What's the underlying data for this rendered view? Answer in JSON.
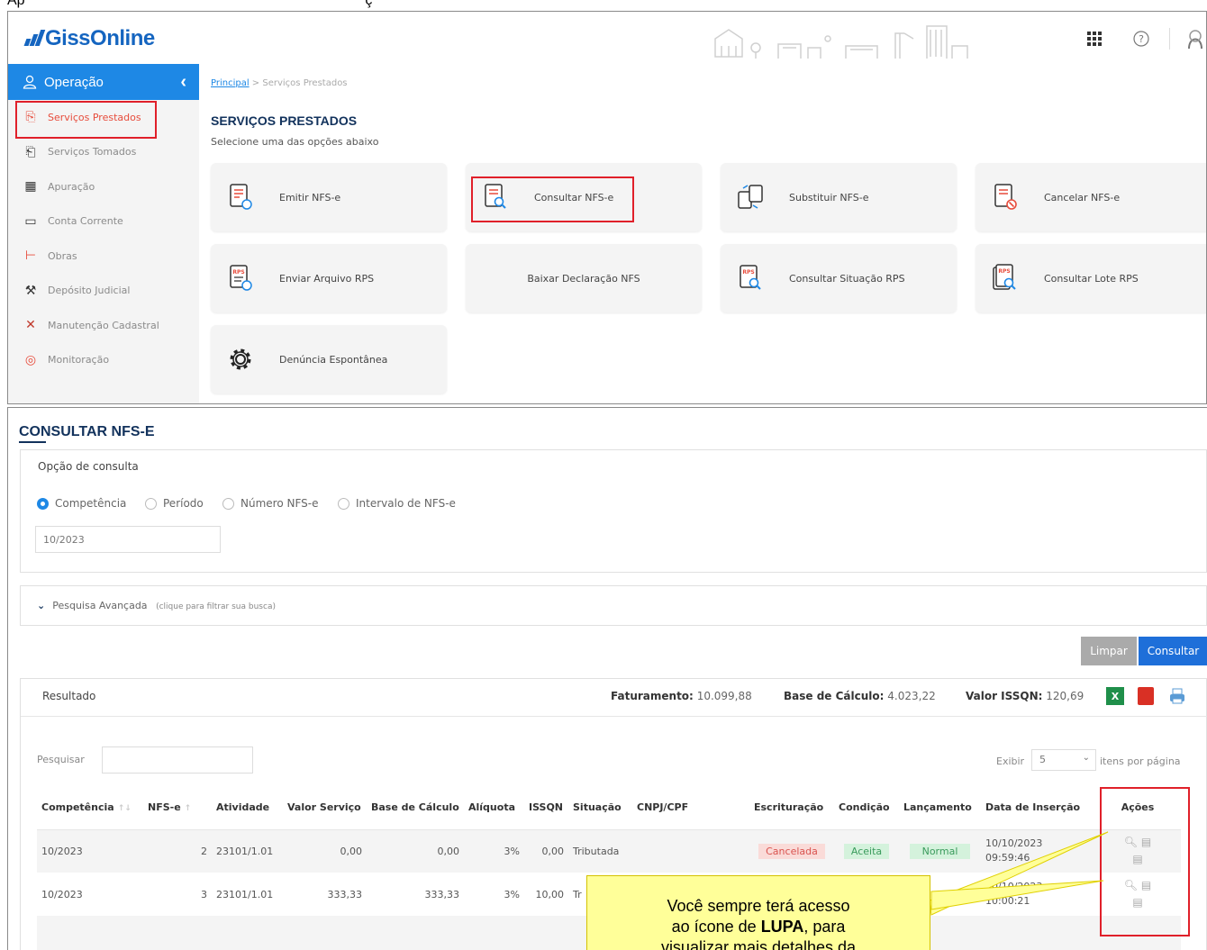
{
  "top_cut_text": "Ap                                                                                     ç",
  "brand": {
    "name": "GissOnline"
  },
  "sidebar": {
    "section_label": "Operação",
    "items": [
      {
        "label": "Serviços Prestados",
        "icon": "document-arrow-icon"
      },
      {
        "label": "Serviços Tomados",
        "icon": "document-arrow-in-icon"
      },
      {
        "label": "Apuração",
        "icon": "calculator-icon"
      },
      {
        "label": "Conta Corrente",
        "icon": "folder-icon"
      },
      {
        "label": "Obras",
        "icon": "crane-icon"
      },
      {
        "label": "Depósito Judicial",
        "icon": "gavel-icon"
      },
      {
        "label": "Manutenção Cadastral",
        "icon": "tools-icon"
      },
      {
        "label": "Monitoração",
        "icon": "eye-icon"
      }
    ]
  },
  "breadcrumb": {
    "home": "Principal",
    "sep": " > ",
    "current": "Serviços Prestados"
  },
  "services": {
    "title": "SERVIÇOS PRESTADOS",
    "subtitle": "Selecione uma das opções abaixo",
    "cards": [
      {
        "label": "Emitir NFS-e",
        "icon": "document-gear-icon"
      },
      {
        "label": "Consultar NFS-e",
        "icon": "document-search-icon"
      },
      {
        "label": "Substituir NFS-e",
        "icon": "document-swap-icon"
      },
      {
        "label": "Cancelar NFS-e",
        "icon": "document-cancel-icon"
      },
      {
        "label": "Enviar Arquivo RPS",
        "icon": "rps-upload-icon"
      },
      {
        "label": "Baixar Declaração NFS",
        "icon": ""
      },
      {
        "label": "Consultar Situação RPS",
        "icon": "rps-search-icon"
      },
      {
        "label": "Consultar Lote RPS",
        "icon": "rps-lot-search-icon"
      },
      {
        "label": "Denúncia Espontânea",
        "icon": "gear-icon"
      }
    ]
  },
  "consult": {
    "title": "CONSULTAR NFS-E",
    "option_label": "Opção de consulta",
    "radios": [
      "Competência",
      "Período",
      "Número NFS-e",
      "Intervalo de NFS-e"
    ],
    "selected_radio": "Competência",
    "competencia_value": "10/2023",
    "advanced_label": "Pesquisa Avançada",
    "advanced_hint": "(clique para filtrar sua busca)",
    "btn_clear": "Limpar",
    "btn_search": "Consultar"
  },
  "result": {
    "label": "Resultado",
    "faturamento_label": "Faturamento:",
    "faturamento_value": "10.099,88",
    "base_label": "Base de Cálculo:",
    "base_value": "4.023,22",
    "iss_label": "Valor ISSQN:",
    "iss_value": "120,69",
    "search_label": "Pesquisar",
    "show_label": "Exibir",
    "per_page": "5",
    "per_page_suffix": "itens por página",
    "columns": [
      "Competência",
      "NFS-e",
      "Atividade",
      "Valor Serviço",
      "Base de Cálculo",
      "Alíquota",
      "ISSQN",
      "Situação",
      "CNPJ/CPF",
      "Escrituração",
      "Condição",
      "Lançamento",
      "Data de Inserção",
      "Ações"
    ],
    "rows": [
      {
        "competencia": "10/2023",
        "nfse": "2",
        "atividade": "23101/1.01",
        "valor": "0,00",
        "base": "0,00",
        "aliquota": "3%",
        "issqn": "0,00",
        "situacao": "Tributada",
        "cnpj": "",
        "escrituracao": "Cancelada",
        "condicao": "Aceita",
        "lancamento": "Normal",
        "data": "10/10/2023",
        "hora": "09:59:46"
      },
      {
        "competencia": "10/2023",
        "nfse": "3",
        "atividade": "23101/1.01",
        "valor": "333,33",
        "base": "333,33",
        "aliquota": "3%",
        "issqn": "10,00",
        "situacao": "Tr",
        "cnpj": "",
        "escrituracao": "",
        "condicao": "",
        "lancamento": "",
        "data": "10/10/2023",
        "hora": "10:00:21"
      }
    ]
  },
  "callout": {
    "line1": "Você sempre terá acesso",
    "line2_prefix": "ao ícone de ",
    "line2_bold": "LUPA",
    "line2_suffix": ", para",
    "line3": "visualizar mais detalhes da"
  }
}
